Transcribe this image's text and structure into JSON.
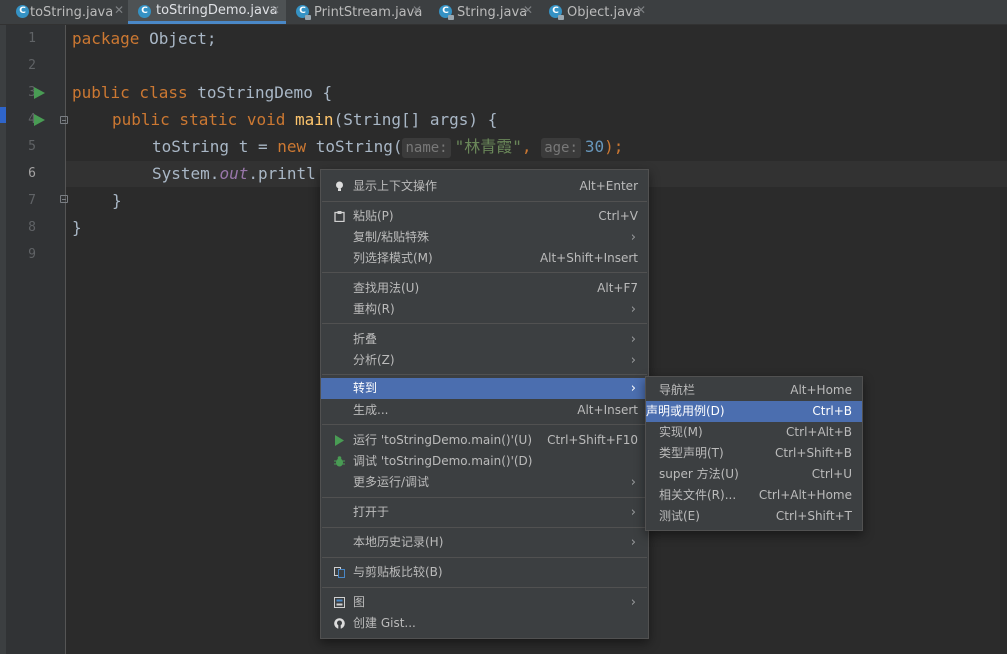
{
  "tabs": [
    {
      "label": "toString.java",
      "active": false,
      "read_only": false
    },
    {
      "label": "toStringDemo.java",
      "active": true,
      "read_only": false
    },
    {
      "label": "PrintStream.java",
      "active": false,
      "read_only": true
    },
    {
      "label": "String.java",
      "active": false,
      "read_only": true
    },
    {
      "label": "Object.java",
      "active": false,
      "read_only": true
    }
  ],
  "tab_close_glyph": "✕",
  "tab_icon_letter": "C",
  "line_numbers": [
    "1",
    "2",
    "3",
    "4",
    "5",
    "6",
    "7",
    "8",
    "9"
  ],
  "current_line": "6",
  "code": {
    "l1_kw": "package",
    "l1_rest": " Object;",
    "l3_kw": "public class",
    "l3_rest": " toStringDemo {",
    "l4_kw": "public static void",
    "l4_fn": "main",
    "l4_rest": "(String[] args) {",
    "l5_a": "toString t = ",
    "l5_kw": "new",
    "l5_b": " toString(",
    "l5_hint1": "name:",
    "l5_str": "\"林青霞\"",
    "l5_comma": ",",
    "l5_hint2": "age:",
    "l5_num": "30",
    "l5_end": ");",
    "l6_a": "System.",
    "l6_fld": "out",
    "l6_b": ".printl",
    "l7": "}",
    "l8": "}"
  },
  "context_menu": {
    "show_context_actions": {
      "label": "显示上下文操作",
      "shortcut": "Alt+Enter",
      "icon": "lightbulb-icon"
    },
    "paste": {
      "label": "粘贴(P)",
      "shortcut": "Ctrl+V",
      "icon": "clipboard-icon"
    },
    "copy_paste_special": {
      "label": "复制/粘贴特殊"
    },
    "column_selection": {
      "label": "列选择模式(M)",
      "shortcut": "Alt+Shift+Insert"
    },
    "find_usages": {
      "label": "查找用法(U)",
      "shortcut": "Alt+F7"
    },
    "refactor": {
      "label": "重构(R)"
    },
    "folding": {
      "label": "折叠"
    },
    "analyze": {
      "label": "分析(Z)"
    },
    "goto": {
      "label": "转到"
    },
    "generate": {
      "label": "生成...",
      "shortcut": "Alt+Insert"
    },
    "run": {
      "label": "运行 'toStringDemo.main()'(U)",
      "shortcut": "Ctrl+Shift+F10",
      "icon": "run-icon"
    },
    "debug": {
      "label": "调试 'toStringDemo.main()'(D)",
      "icon": "debug-icon"
    },
    "more_run_debug": {
      "label": "更多运行/调试"
    },
    "open_in": {
      "label": "打开于"
    },
    "local_history": {
      "label": "本地历史记录(H)"
    },
    "compare_clipboard": {
      "label": "与剪贴板比较(B)",
      "icon": "compare-icon"
    },
    "diagrams": {
      "label": "图",
      "icon": "diagram-icon"
    },
    "create_gist": {
      "label": "创建 Gist...",
      "icon": "github-icon"
    },
    "submenu_arrow": "›"
  },
  "goto_submenu": {
    "navigation_bar": {
      "label": "导航栏",
      "shortcut": "Alt+Home"
    },
    "declaration": {
      "label": "声明或用例(D)",
      "shortcut": "Ctrl+B"
    },
    "implementation": {
      "label": "实现(M)",
      "shortcut": "Ctrl+Alt+B"
    },
    "type_declaration": {
      "label": "类型声明(T)",
      "shortcut": "Ctrl+Shift+B"
    },
    "super_method": {
      "label": "super 方法(U)",
      "shortcut": "Ctrl+U"
    },
    "related_file": {
      "label": "相关文件(R)...",
      "shortcut": "Ctrl+Alt+Home"
    },
    "test": {
      "label": "测试(E)",
      "shortcut": "Ctrl+Shift+T"
    }
  },
  "colors": {
    "editor_bg": "#2b2b2b",
    "menu_bg": "#3c3f41",
    "menu_highlight": "#4b6eaf",
    "keyword": "#cc7832",
    "string": "#6a8759",
    "number": "#6897bb",
    "run_green": "#499c54"
  }
}
